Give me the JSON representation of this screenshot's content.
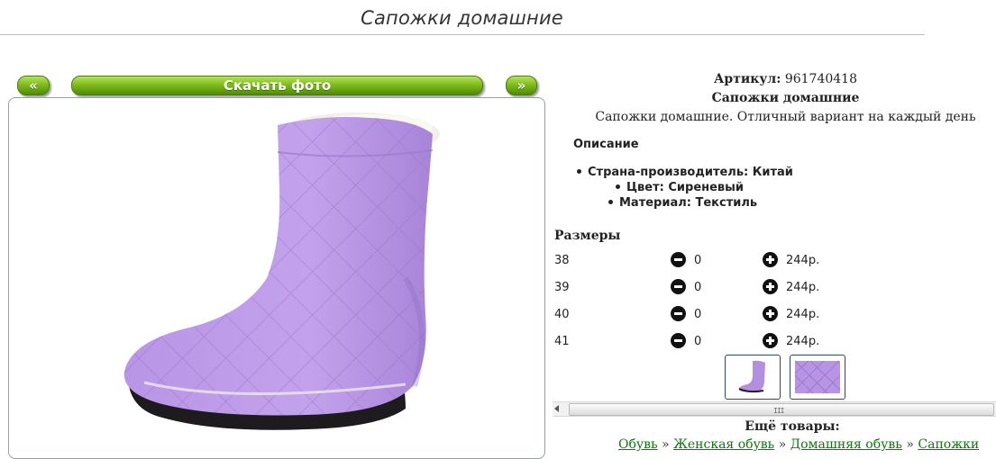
{
  "page": {
    "title": "Сапожки домашние"
  },
  "gallery": {
    "prev_label": "«",
    "download_label": "Скачать фото",
    "next_label": "»"
  },
  "product": {
    "article_label": "Артикул:",
    "article_value": "961740418",
    "name": "Сапожки домашние",
    "description": "Сапожки домашние. Отличный вариант на каждый день",
    "description_heading": "Описание",
    "specs": [
      {
        "text": "Страна-производитель: Китай"
      },
      {
        "text": "Цвет: Сиреневый"
      },
      {
        "text": "Материал: Текстиль"
      }
    ]
  },
  "sizes": {
    "heading": "Размеры",
    "rows": [
      {
        "size": "38",
        "qty": "0",
        "price": "244р."
      },
      {
        "size": "39",
        "qty": "0",
        "price": "244р."
      },
      {
        "size": "40",
        "qty": "0",
        "price": "244р."
      },
      {
        "size": "41",
        "qty": "0",
        "price": "244р."
      }
    ]
  },
  "scrollbar": {
    "grip": "III"
  },
  "more": {
    "heading": "Ещё товары:",
    "breadcrumbs": [
      "Обувь",
      "Женская обувь",
      "Домашняя обувь",
      "Сапожки"
    ],
    "separator": "»"
  },
  "colors": {
    "button_green": "#7fbc1d",
    "link_green": "#0a7a0a",
    "boot_lilac": "#b48fe0"
  }
}
